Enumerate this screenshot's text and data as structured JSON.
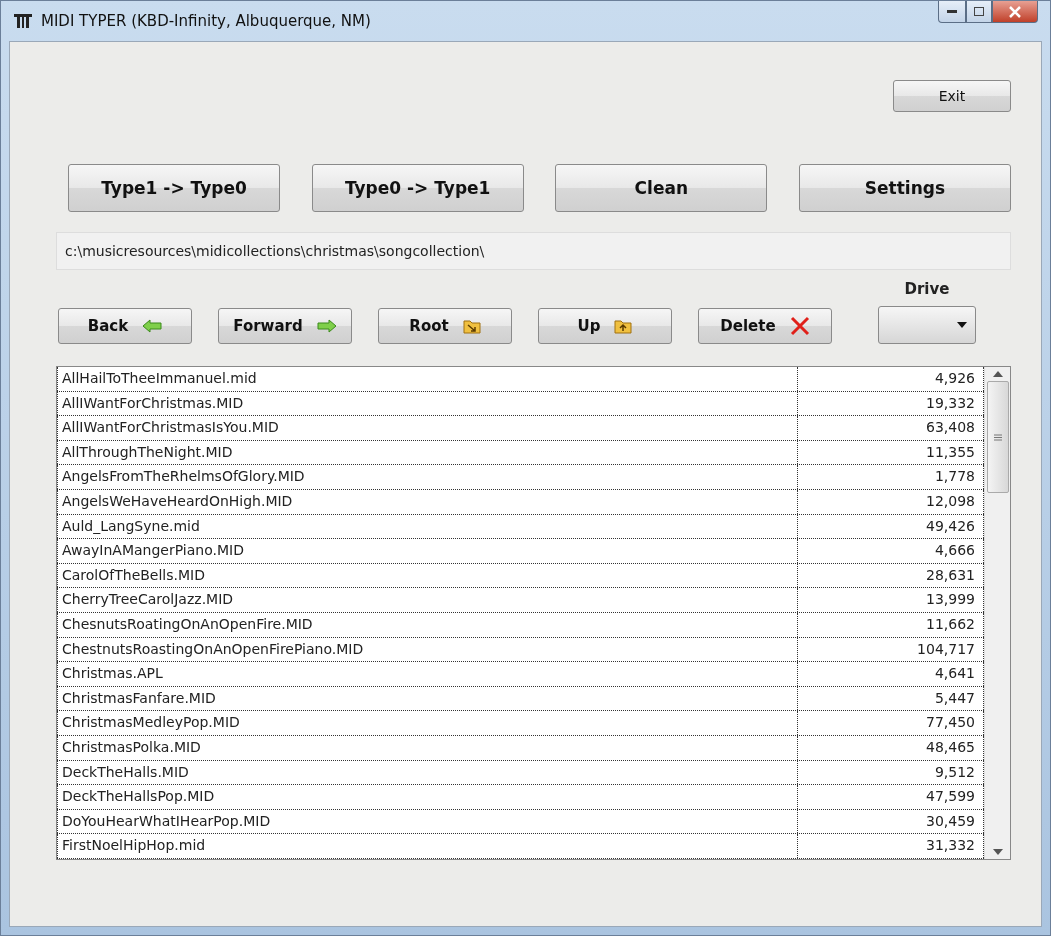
{
  "window": {
    "title": "MIDI TYPER (KBD-Infinity, Albuquerque, NM)"
  },
  "exit_button": "Exit",
  "actions": [
    {
      "label": "Type1 -> Type0"
    },
    {
      "label": "Type0 -> Type1"
    },
    {
      "label": "Clean"
    },
    {
      "label": "Settings"
    }
  ],
  "path": {
    "value": "c:\\musicresources\\midicollections\\christmas\\songcollection\\"
  },
  "navigation": [
    {
      "label": "Back",
      "kind": "back"
    },
    {
      "label": "Forward",
      "kind": "forward"
    },
    {
      "label": "Root",
      "kind": "root"
    },
    {
      "label": "Up",
      "kind": "up"
    },
    {
      "label": "Delete",
      "kind": "delete"
    }
  ],
  "drive": {
    "label": "Drive"
  },
  "files": [
    {
      "name": "AllHailToTheeImmanuel.mid",
      "size": "4,926"
    },
    {
      "name": "AllIWantForChristmas.MID",
      "size": "19,332"
    },
    {
      "name": "AllIWantForChristmasIsYou.MID",
      "size": "63,408"
    },
    {
      "name": "AllThroughTheNight.MID",
      "size": "11,355"
    },
    {
      "name": "AngelsFromTheRhelmsOfGlory.MID",
      "size": "1,778"
    },
    {
      "name": "AngelsWeHaveHeardOnHigh.MID",
      "size": "12,098"
    },
    {
      "name": "Auld_LangSyne.mid",
      "size": "49,426"
    },
    {
      "name": "AwayInAMangerPiano.MID",
      "size": "4,666"
    },
    {
      "name": "CarolOfTheBells.MID",
      "size": "28,631"
    },
    {
      "name": "CherryTreeCarolJazz.MID",
      "size": "13,999"
    },
    {
      "name": "ChesnutsRoatingOnAnOpenFire.MID",
      "size": "11,662"
    },
    {
      "name": "ChestnutsRoastingOnAnOpenFirePiano.MID",
      "size": "104,717"
    },
    {
      "name": "Christmas.APL",
      "size": "4,641"
    },
    {
      "name": "ChristmasFanfare.MID",
      "size": "5,447"
    },
    {
      "name": "ChristmasMedleyPop.MID",
      "size": "77,450"
    },
    {
      "name": "ChristmasPolka.MID",
      "size": "48,465"
    },
    {
      "name": "DeckTheHalls.MID",
      "size": "9,512"
    },
    {
      "name": "DeckTheHallsPop.MID",
      "size": "47,599"
    },
    {
      "name": "DoYouHearWhatIHearPop.MID",
      "size": "30,459"
    },
    {
      "name": "FirstNoelHipHop.mid",
      "size": "31,332"
    }
  ]
}
